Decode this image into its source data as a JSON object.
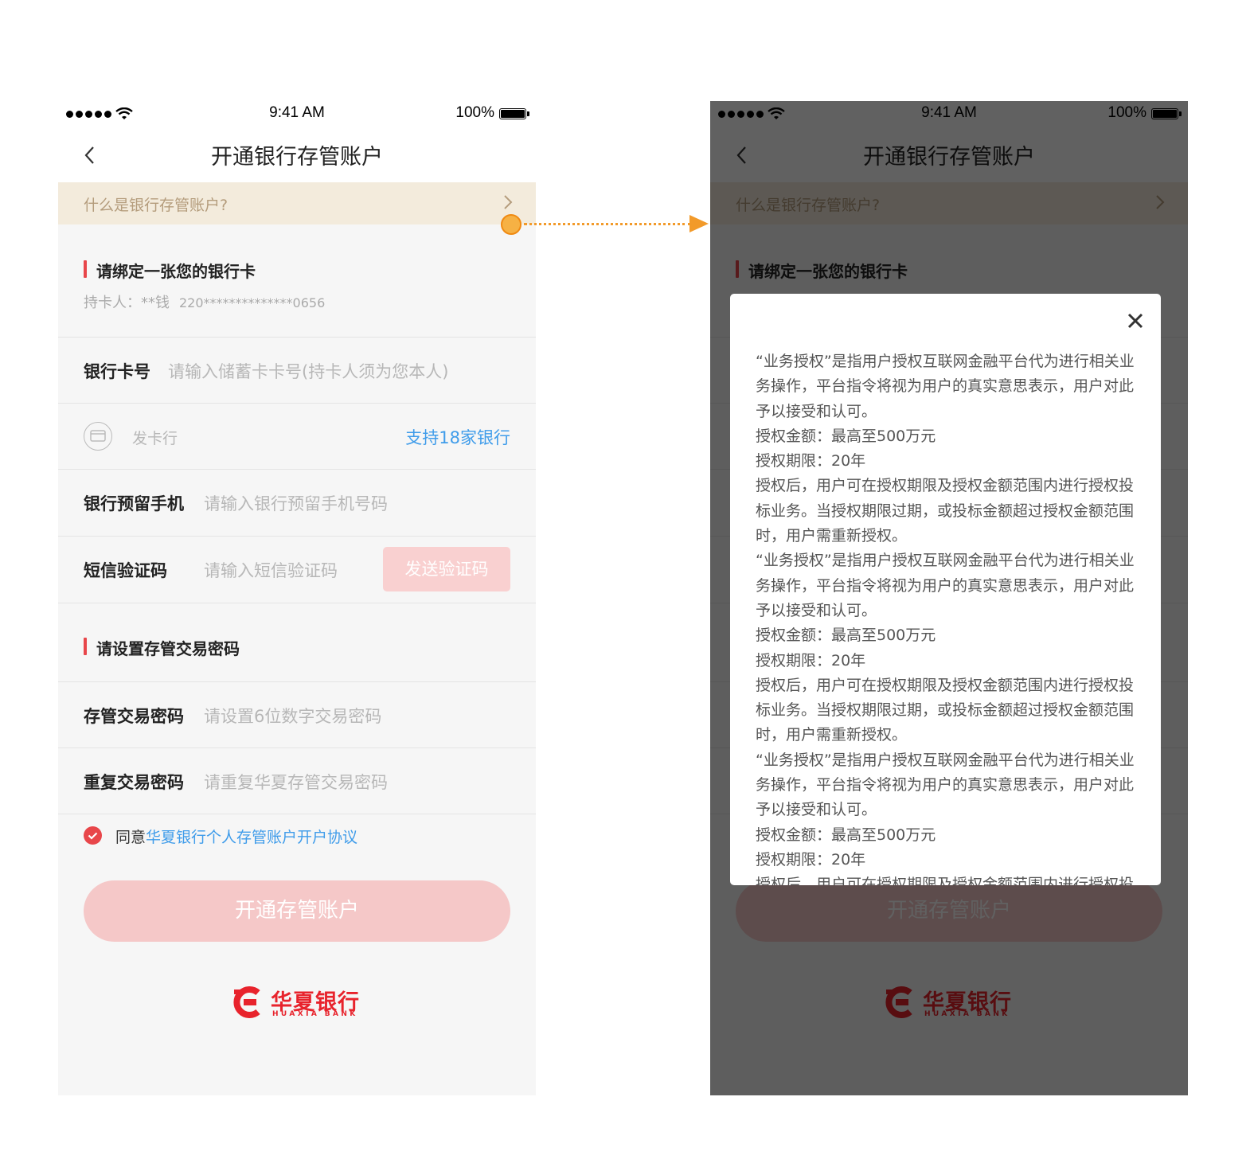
{
  "status_bar": {
    "time": "9:41 AM",
    "battery": "100%"
  },
  "nav": {
    "title": "开通银行存管账户"
  },
  "banner": {
    "text": "什么是银行存管账户?"
  },
  "bind_section": {
    "title": "请绑定一张您的银行卡",
    "holder_label": "持卡人：",
    "holder_name": "**钱",
    "card_number": "220**************0656"
  },
  "fields": {
    "card_no": {
      "label": "银行卡号",
      "placeholder": "请输入储蓄卡卡号(持卡人须为您本人)"
    },
    "issuer": {
      "label": "发卡行",
      "link": "支持18家银行"
    },
    "phone": {
      "label": "银行预留手机",
      "placeholder": "请输入银行预留手机号码"
    },
    "sms": {
      "label": "短信验证码",
      "placeholder": "请输入短信验证码",
      "button": "发送验证码"
    }
  },
  "password_section": {
    "title": "请设置存管交易密码"
  },
  "password_fields": {
    "password": {
      "label": "存管交易密码",
      "placeholder": "请设置6位数字交易密码"
    },
    "repeat": {
      "label": "重复交易密码",
      "placeholder": "请重复华夏存管交易密码"
    }
  },
  "agreement": {
    "prefix": "同意",
    "link": "华夏银行个人存管账户开户协议",
    "checked": true
  },
  "submit_button": "开通存管账户",
  "logo": {
    "cn": "华夏银行",
    "en": "HUAXIA BANK"
  },
  "modal": {
    "paragraphs": [
      "“业务授权”是指用户授权互联网金融平台代为进行相关业务操作，平台指令将视为用户的真实意思表示，用户对此予以接受和认可。",
      "授权金额：最高至500万元",
      "授权期限：20年",
      "授权后，用户可在授权期限及授权金额范围内进行授权投标业务。当授权期限过期，或投标金额超过授权金额范围时，用户需重新授权。",
      "“业务授权”是指用户授权互联网金融平台代为进行相关业务操作，平台指令将视为用户的真实意思表示，用户对此予以接受和认可。",
      "授权金额：最高至500万元",
      "授权期限：20年",
      "授权后，用户可在授权期限及授权金额范围内进行授权投标业务。当授权期限过期，或投标金额超过授权金额范围时，用户需重新授权。",
      "“业务授权”是指用户授权互联网金融平台代为进行相关业务操作，平台指令将视为用户的真实意思表示，用户对此予以接受和认可。",
      "授权金额：最高至500万元",
      "授权期限：20年",
      "授权后，用户可在授权期限及授权金额范围内进行授权投标业务。当授权期限过期，或投标金额超过授权金额范围时，用户需重新授权。"
    ]
  },
  "colors": {
    "accent_red": "#e8464a",
    "link_blue": "#3f9cea",
    "banner_bg": "#f3ebdc",
    "connector": "#f29a2a"
  }
}
